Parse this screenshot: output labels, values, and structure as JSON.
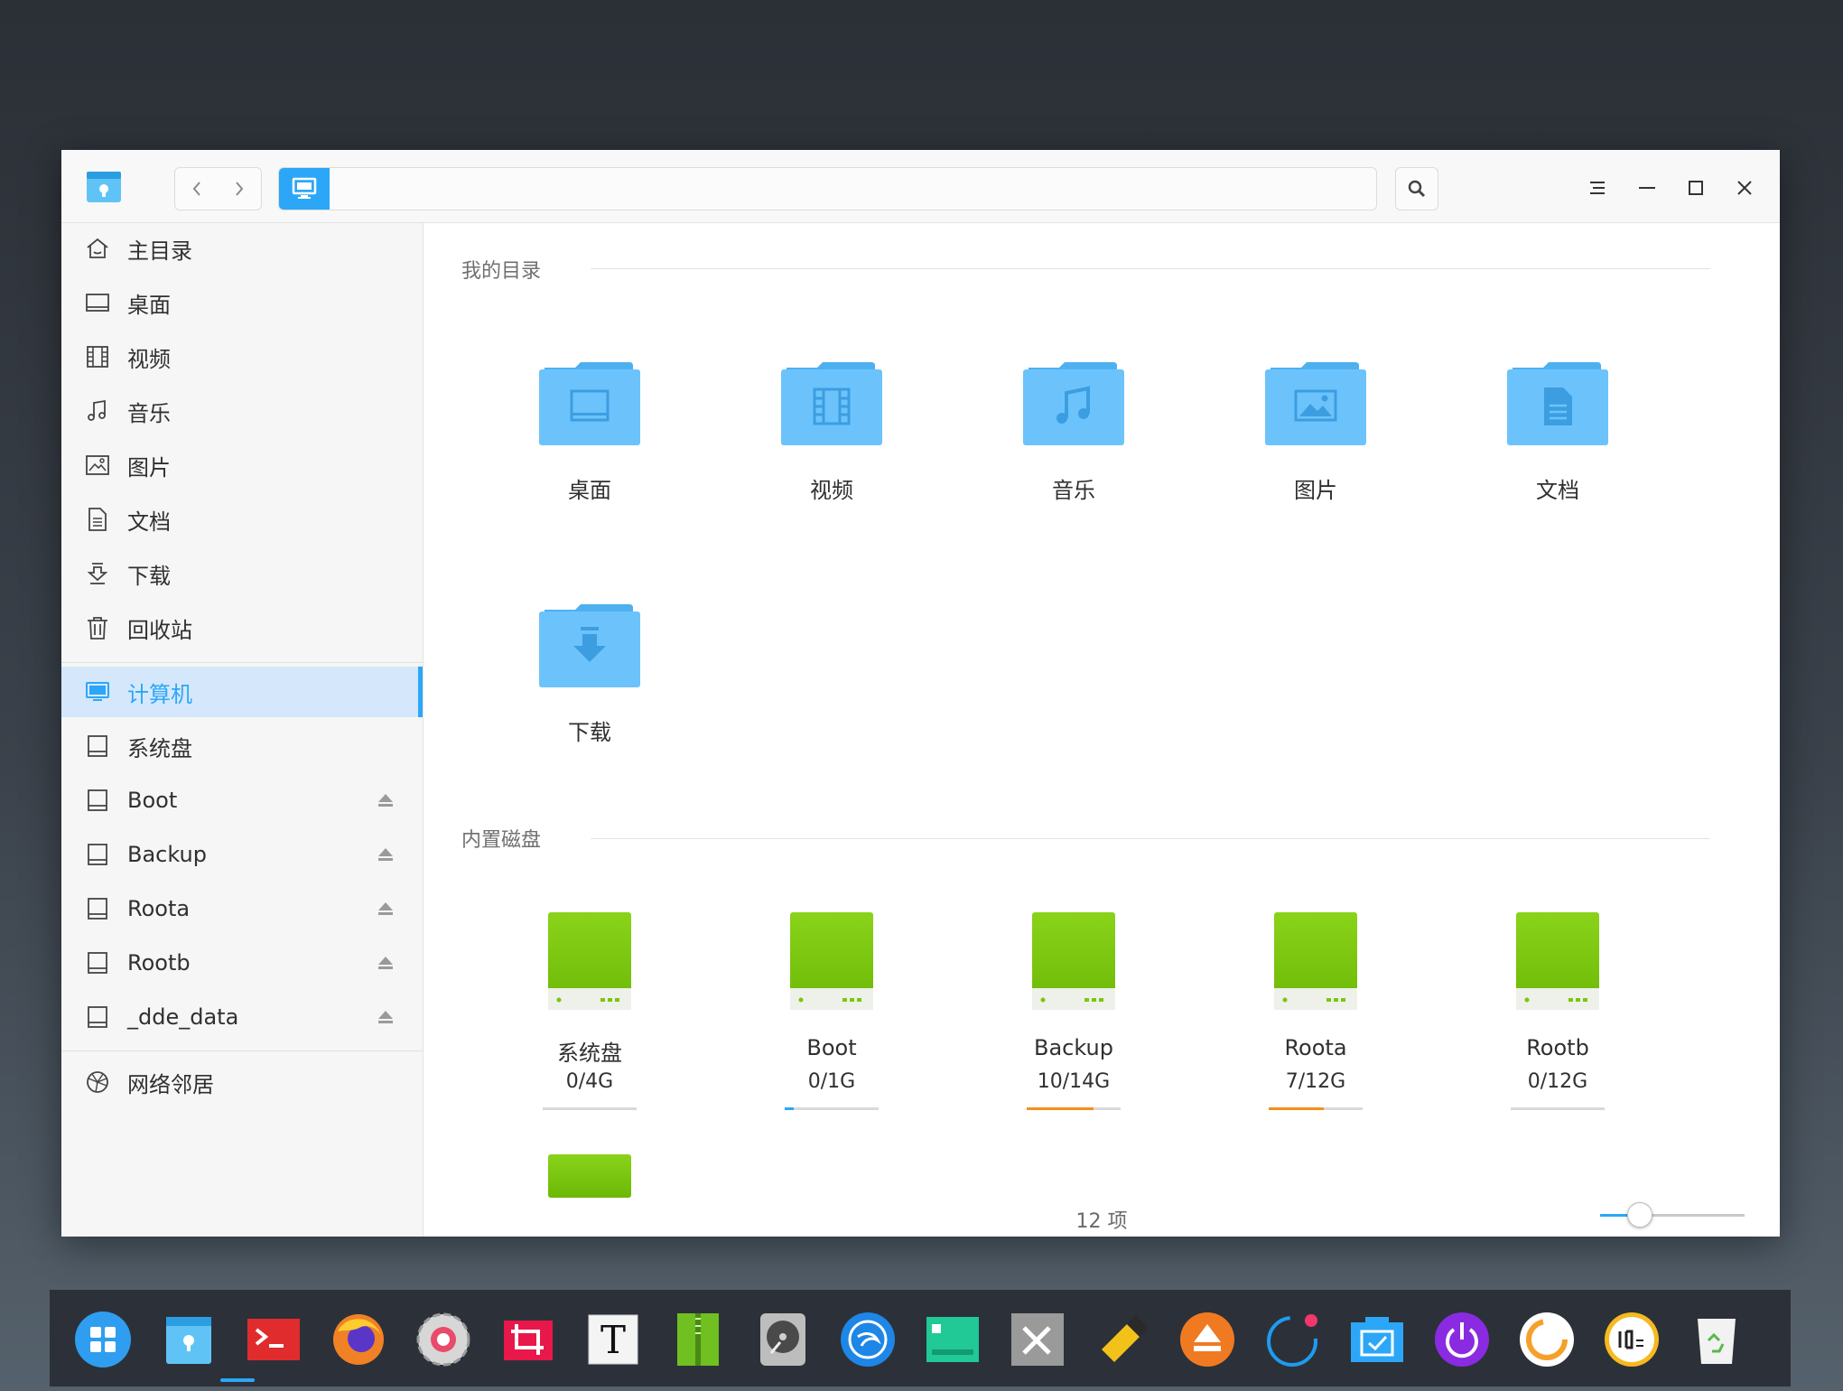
{
  "sidebar": {
    "items": [
      {
        "label": "主目录",
        "icon": "home-icon"
      },
      {
        "label": "桌面",
        "icon": "desktop-icon"
      },
      {
        "label": "视频",
        "icon": "video-icon"
      },
      {
        "label": "音乐",
        "icon": "music-icon"
      },
      {
        "label": "图片",
        "icon": "picture-icon"
      },
      {
        "label": "文档",
        "icon": "document-icon"
      },
      {
        "label": "下载",
        "icon": "download-icon"
      },
      {
        "label": "回收站",
        "icon": "trash-icon"
      }
    ],
    "computer": {
      "label": "计算机",
      "icon": "computer-icon",
      "active": true
    },
    "disks": [
      {
        "label": "系统盘",
        "icon": "disk-icon",
        "eject": false
      },
      {
        "label": "Boot",
        "icon": "disk-icon",
        "eject": true
      },
      {
        "label": "Backup",
        "icon": "disk-icon",
        "eject": true
      },
      {
        "label": "Roota",
        "icon": "disk-icon",
        "eject": true
      },
      {
        "label": "Rootb",
        "icon": "disk-icon",
        "eject": true
      },
      {
        "label": "_dde_data",
        "icon": "disk-icon",
        "eject": true
      }
    ],
    "network": {
      "label": "网络邻居",
      "icon": "network-icon"
    }
  },
  "main": {
    "my_dirs_title": "我的目录",
    "folders": [
      {
        "label": "桌面",
        "icon": "desktop-icon"
      },
      {
        "label": "视频",
        "icon": "video-icon"
      },
      {
        "label": "音乐",
        "icon": "music-icon"
      },
      {
        "label": "图片",
        "icon": "picture-icon"
      },
      {
        "label": "文档",
        "icon": "document-icon"
      },
      {
        "label": "下载",
        "icon": "download-icon"
      }
    ],
    "disks_title": "内置磁盘",
    "disks": [
      {
        "label": "系统盘",
        "usage": "0/4G",
        "used": 0,
        "total": 4,
        "bar_color": "#2ca7f8"
      },
      {
        "label": "Boot",
        "usage": "0/1G",
        "used": 0,
        "total": 1,
        "bar_color": "#2ca7f8"
      },
      {
        "label": "Backup",
        "usage": "10/14G",
        "used": 10,
        "total": 14,
        "bar_color": "#f4901e"
      },
      {
        "label": "Roota",
        "usage": "7/12G",
        "used": 7,
        "total": 12,
        "bar_color": "#f4901e"
      },
      {
        "label": "Rootb",
        "usage": "0/12G",
        "used": 0,
        "total": 12,
        "bar_color": "#2ca7f8"
      }
    ],
    "status": "12 项",
    "zoom_level": 0.27
  },
  "colors": {
    "accent": "#2ca7f8",
    "folder": "#6cc3fb",
    "disk": "#7ac70c",
    "warning": "#f4901e"
  },
  "dock": {
    "icons": [
      "launcher-icon",
      "file-manager-icon",
      "terminal-icon",
      "firefox-icon",
      "settings-icon",
      "screenshot-icon",
      "text-editor-icon",
      "archive-manager-icon",
      "disk-utility-icon",
      "deepin-store-icon",
      "system-monitor-icon",
      "tools-icon",
      "usb-writer-icon",
      "eject-app-icon",
      "music-player-icon",
      "screen-capture-icon",
      "shutdown-icon",
      "movie-player-icon",
      "clock-icon",
      "trash-icon"
    ]
  }
}
